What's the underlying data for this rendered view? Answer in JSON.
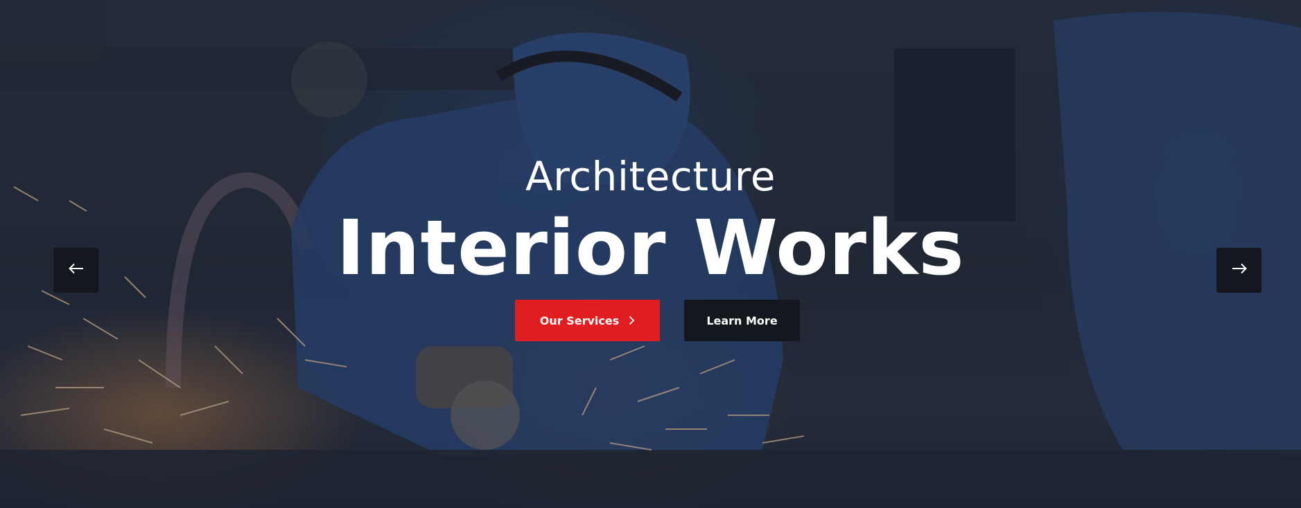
{
  "hero": {
    "subtitle": "Architecture",
    "title": "Interior Works",
    "primary_button": {
      "label": "Our Services",
      "icon": "chevron-right-icon",
      "color": "#e01e1f"
    },
    "secondary_button": {
      "label": "Learn More",
      "color": "#14171d"
    }
  },
  "slider": {
    "prev_icon": "arrow-left-icon",
    "next_icon": "arrow-right-icon"
  },
  "background": {
    "description_icon": "welding-worker-photo"
  }
}
